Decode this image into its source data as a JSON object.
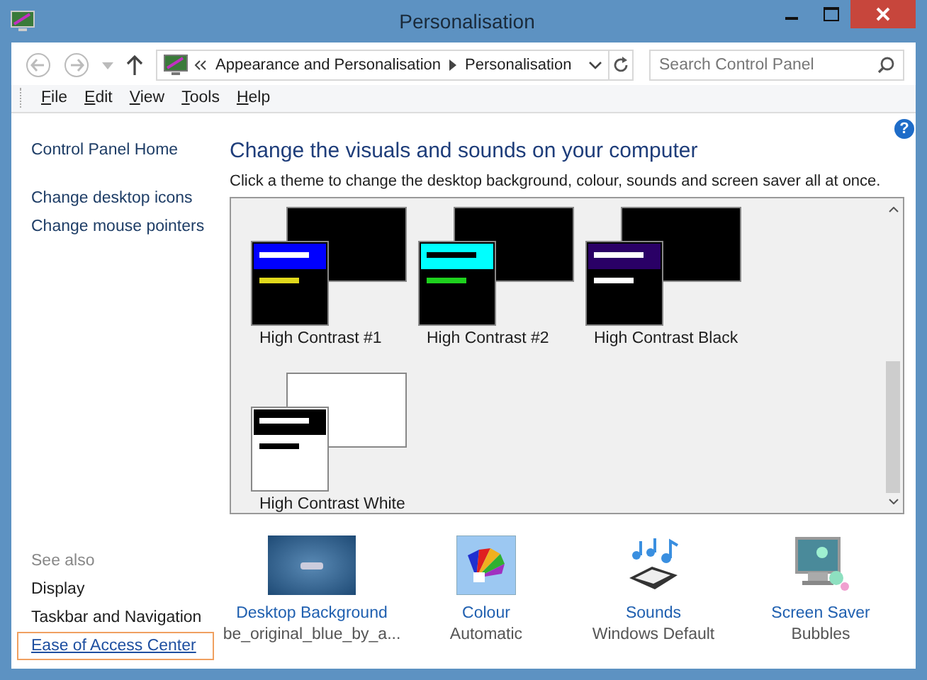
{
  "window": {
    "title": "Personalisation"
  },
  "address": {
    "crumbs": [
      "Appearance and Personalisation",
      "Personalisation"
    ],
    "search": {
      "placeholder": "Search Control Panel"
    }
  },
  "menu": [
    "File",
    "Edit",
    "View",
    "Tools",
    "Help"
  ],
  "sidebar": {
    "items": [
      {
        "label": "Control Panel Home",
        "kind": "link"
      },
      {
        "label": "Change desktop icons",
        "kind": "link"
      },
      {
        "label": "Change mouse pointers",
        "kind": "link"
      }
    ],
    "see_also": {
      "heading": "See also",
      "items": [
        {
          "label": "Display",
          "focused": false
        },
        {
          "label": "Taskbar and Navigation",
          "focused": false
        },
        {
          "label": "Ease of Access Center",
          "focused": true
        }
      ]
    }
  },
  "main": {
    "help": "?",
    "heading": "Change the visuals and sounds on your computer",
    "description": "Click a theme to change the desktop background, colour, sounds and screen saver all at once.",
    "themes": [
      {
        "name": "High Contrast #1",
        "kind": "hc1",
        "color": "#0000ff"
      },
      {
        "name": "High Contrast #2",
        "kind": "hc2",
        "color": "#00ffff"
      },
      {
        "name": "High Contrast Black",
        "kind": "black",
        "color": "#2a0066"
      },
      {
        "name": "High Contrast White",
        "kind": "white",
        "color": "#000000"
      }
    ],
    "settings": [
      {
        "kind": "background",
        "label": "Desktop Background",
        "value": "be_original_blue_by_a..."
      },
      {
        "kind": "colour",
        "label": "Colour",
        "value": "Automatic"
      },
      {
        "kind": "sounds",
        "label": "Sounds",
        "value": "Windows Default"
      },
      {
        "kind": "screensaver",
        "label": "Screen Saver",
        "value": "Bubbles"
      }
    ]
  }
}
